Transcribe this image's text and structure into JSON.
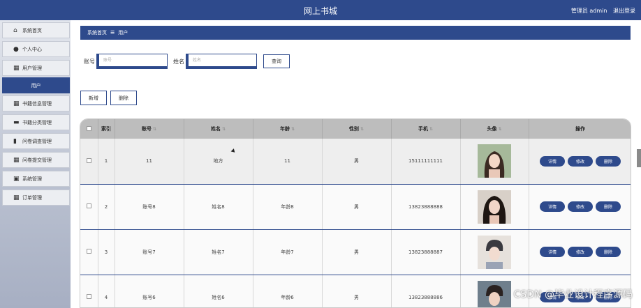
{
  "header": {
    "title": "网上书城",
    "user_label": "管理员 admin",
    "logout": "退出登录"
  },
  "sidebar": {
    "items": [
      {
        "label": "系统首页",
        "icon": "home-icon"
      },
      {
        "label": "个人中心",
        "icon": "person-icon"
      },
      {
        "label": "用户管理",
        "icon": "grid-icon"
      },
      {
        "label": "用户",
        "icon": "",
        "active": true
      },
      {
        "label": "书籍信息管理",
        "icon": "grid-icon"
      },
      {
        "label": "书籍分类管理",
        "icon": "car-icon"
      },
      {
        "label": "问卷调查管理",
        "icon": "doc-icon"
      },
      {
        "label": "问卷提交管理",
        "icon": "grid-icon"
      },
      {
        "label": "系统管理",
        "icon": "lock-icon"
      },
      {
        "label": "订单管理",
        "icon": "grid-icon"
      }
    ]
  },
  "breadcrumb": {
    "home": "系统首页",
    "sep": "☰",
    "current": "用户"
  },
  "search": {
    "account_label": "账号",
    "account_placeholder": "账号",
    "name_label": "姓名",
    "name_placeholder": "姓名",
    "query_button": "查询"
  },
  "actions": {
    "add": "新增",
    "delete": "删除"
  },
  "table": {
    "columns": [
      "索引",
      "账号",
      "姓名",
      "年龄",
      "性别",
      "手机",
      "头像",
      "操作"
    ],
    "rows": [
      {
        "index": "1",
        "account": "11",
        "name": "地方",
        "age": "11",
        "gender": "男",
        "phone": "15111111111"
      },
      {
        "index": "2",
        "account": "账号8",
        "name": "姓名8",
        "age": "年龄8",
        "gender": "男",
        "phone": "13823888888"
      },
      {
        "index": "3",
        "account": "账号7",
        "name": "姓名7",
        "age": "年龄7",
        "gender": "男",
        "phone": "13823888887"
      },
      {
        "index": "4",
        "account": "账号6",
        "name": "姓名6",
        "age": "年龄6",
        "gender": "男",
        "phone": "13823888886"
      }
    ],
    "row_buttons": {
      "detail": "详情",
      "edit": "修改",
      "delete": "删除"
    }
  },
  "watermark": "CSDN @毕业设计程序源码"
}
